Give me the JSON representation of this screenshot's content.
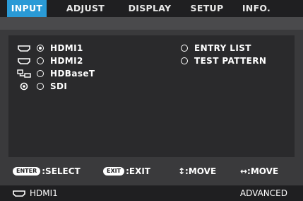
{
  "tabs": [
    {
      "label": "INPUT",
      "active": true
    },
    {
      "label": "ADJUST",
      "active": false
    },
    {
      "label": "DISPLAY",
      "active": false
    },
    {
      "label": "SETUP",
      "active": false
    },
    {
      "label": "INFO.",
      "active": false
    }
  ],
  "sources_left": [
    {
      "label": "HDMI1",
      "icon": "hdmi-icon",
      "selected": true
    },
    {
      "label": "HDMI2",
      "icon": "hdmi-icon",
      "selected": false
    },
    {
      "label": "HDBaseT",
      "icon": "hdbaset-icon",
      "selected": false
    },
    {
      "label": "SDI",
      "icon": "sdi-icon",
      "selected": false
    }
  ],
  "sources_right": [
    {
      "label": "ENTRY LIST",
      "selected": false
    },
    {
      "label": "TEST PATTERN",
      "selected": false
    }
  ],
  "help": {
    "enter_key": "ENTER",
    "enter_text": ":SELECT",
    "exit_key": "EXIT",
    "exit_text": ":EXIT",
    "updown_text": "↕:MOVE",
    "leftright_text": "↔:MOVE"
  },
  "status": {
    "source": "HDMI1",
    "mode": "ADVANCED"
  },
  "colors": {
    "accent": "#2a9ad6",
    "background": "#3a3a3c",
    "panel": "#2a2a2c",
    "bar": "#1f1f21"
  }
}
